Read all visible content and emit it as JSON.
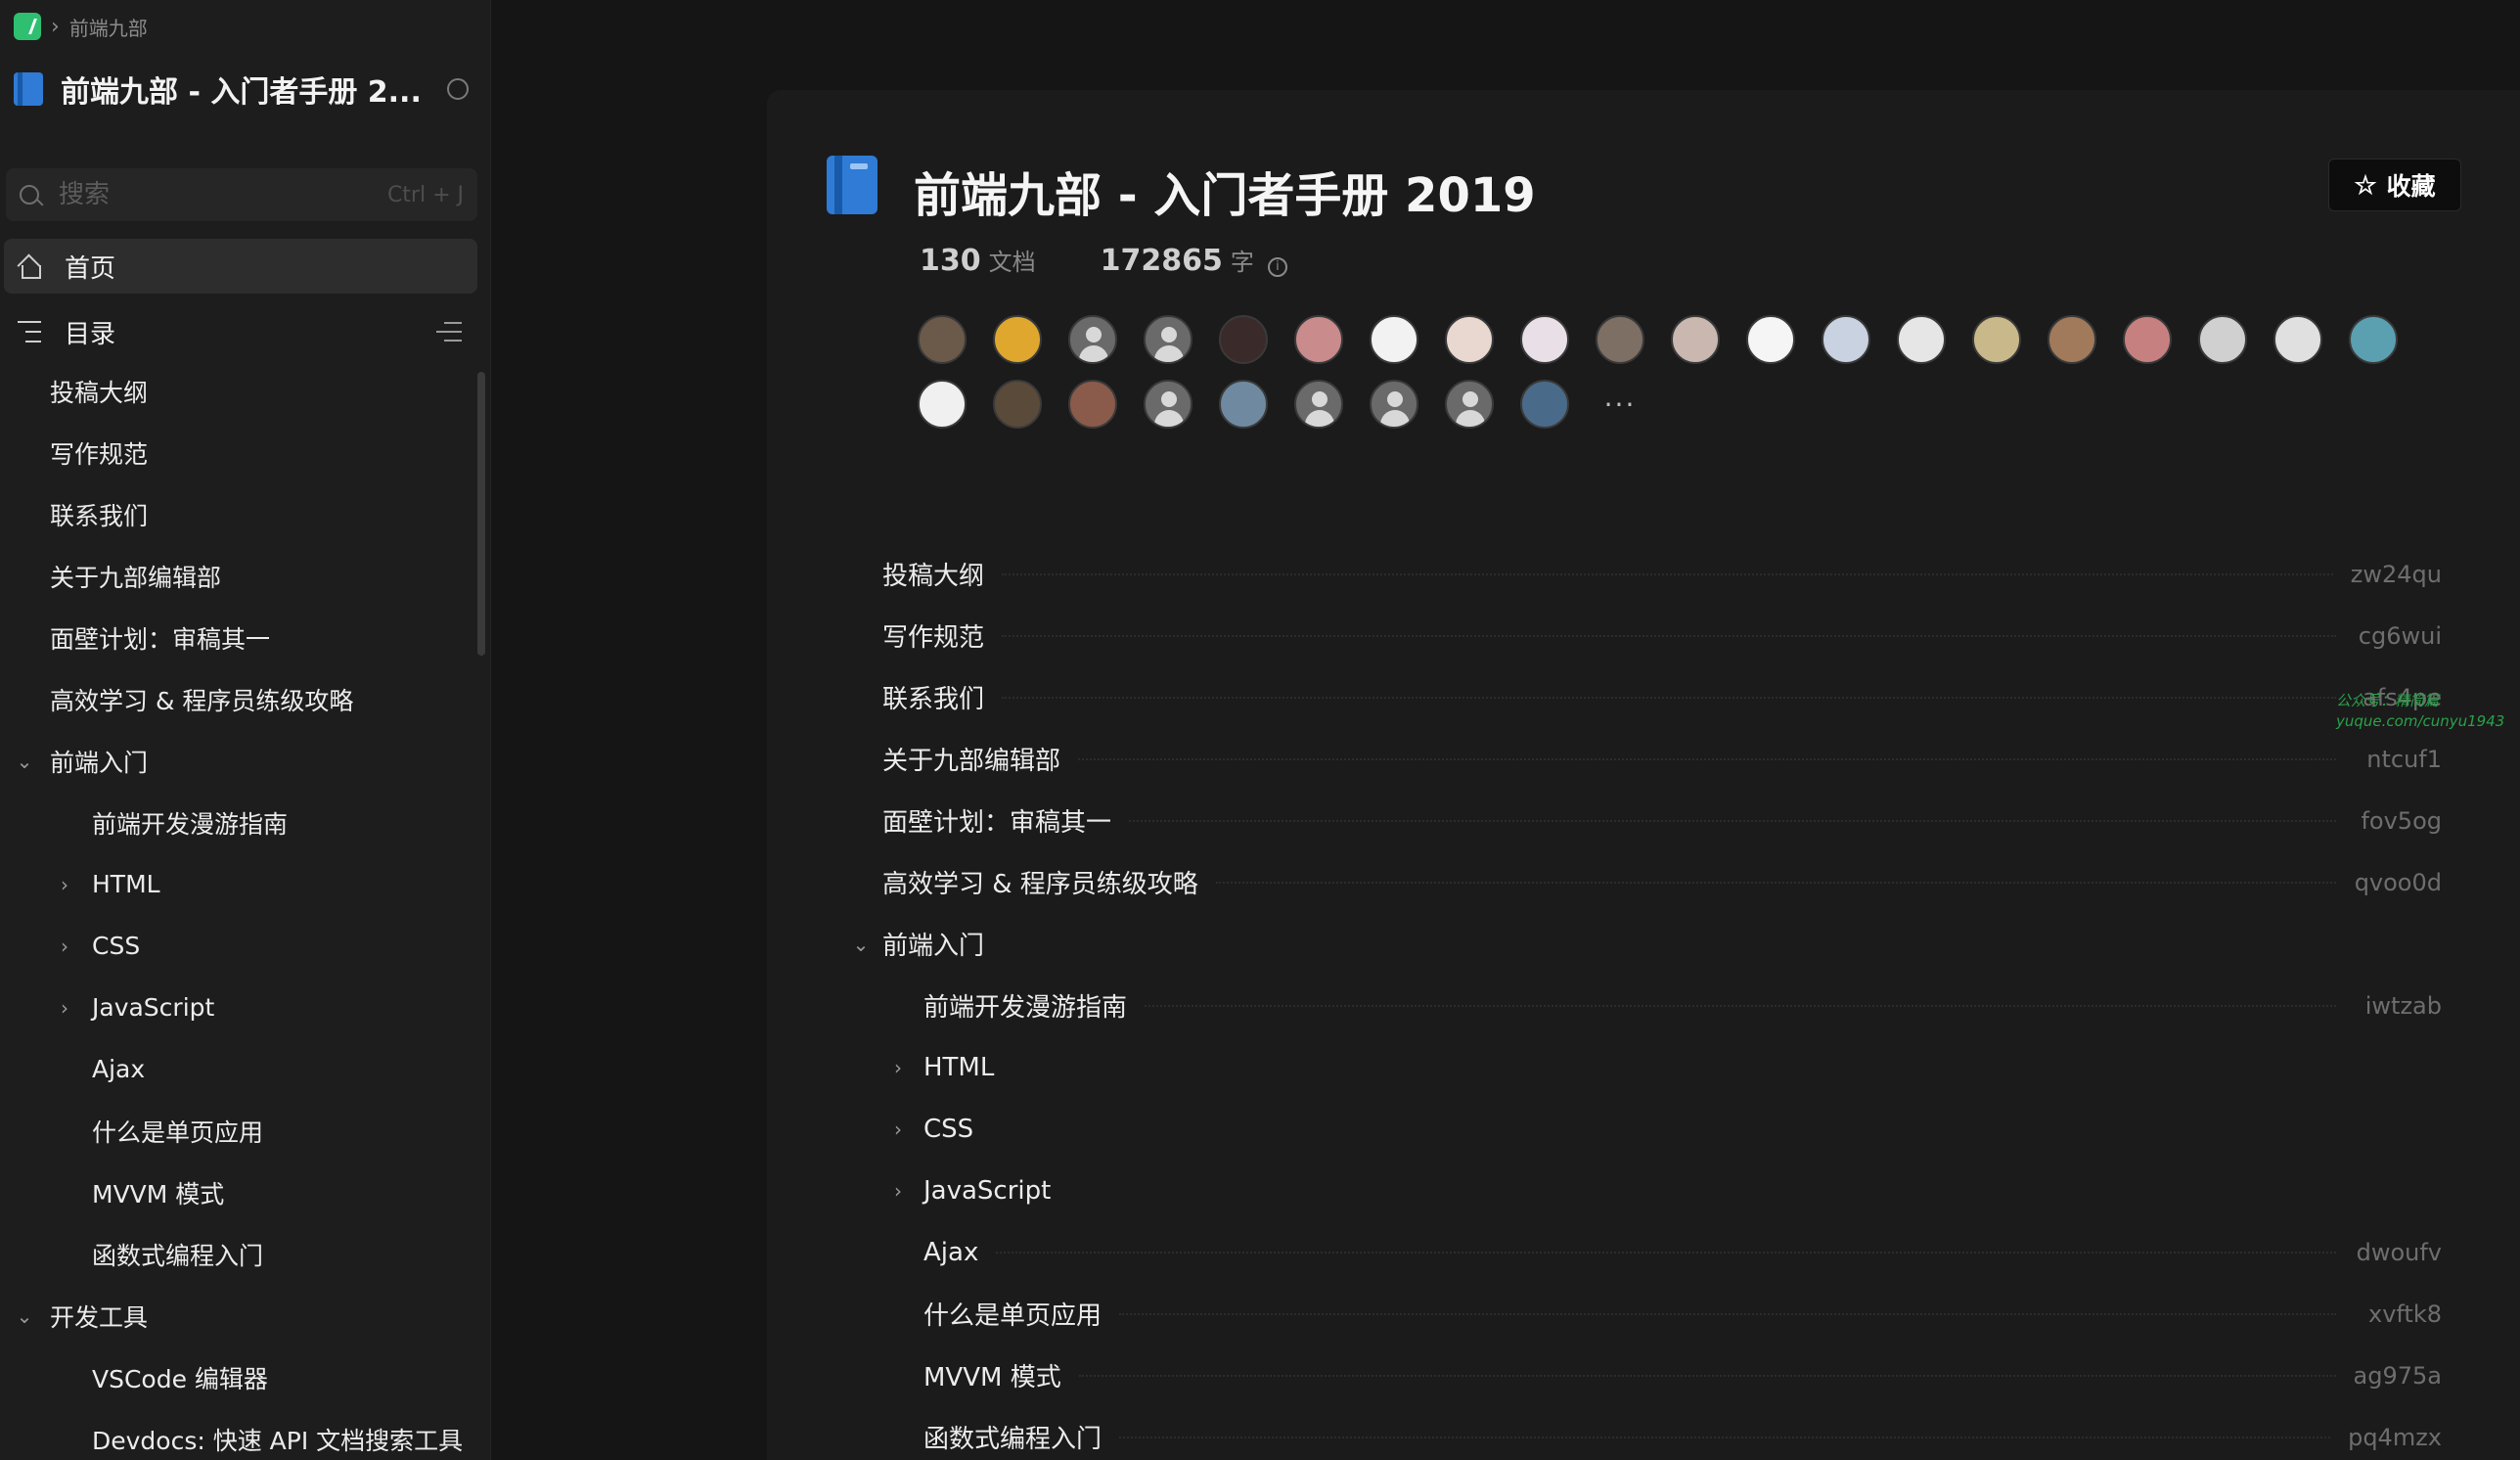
{
  "breadcrumb": {
    "current": "前端九部"
  },
  "sidebar": {
    "book_title": "前端九部 - 入门者手册 2...",
    "search_placeholder": "搜索",
    "search_shortcut": "Ctrl + J",
    "nav_home": "首页",
    "nav_toc": "目录",
    "items": [
      {
        "label": "投稿大纲",
        "level": 1,
        "caret": ""
      },
      {
        "label": "写作规范",
        "level": 1,
        "caret": ""
      },
      {
        "label": "联系我们",
        "level": 1,
        "caret": ""
      },
      {
        "label": "关于九部编辑部",
        "level": 1,
        "caret": ""
      },
      {
        "label": "面壁计划：审稿其一",
        "level": 1,
        "caret": ""
      },
      {
        "label": "高效学习 & 程序员练级攻略",
        "level": 1,
        "caret": ""
      },
      {
        "label": "前端入门",
        "level": 1,
        "caret": "⌄"
      },
      {
        "label": "前端开发漫游指南",
        "level": 2,
        "caret": ""
      },
      {
        "label": "HTML",
        "level": 2,
        "caret": "›"
      },
      {
        "label": "CSS",
        "level": 2,
        "caret": "›"
      },
      {
        "label": "JavaScript",
        "level": 2,
        "caret": "›"
      },
      {
        "label": "Ajax",
        "level": 2,
        "caret": ""
      },
      {
        "label": "什么是单页应用",
        "level": 2,
        "caret": ""
      },
      {
        "label": "MVVM 模式",
        "level": 2,
        "caret": ""
      },
      {
        "label": "函数式编程入门",
        "level": 2,
        "caret": ""
      },
      {
        "label": "开发工具",
        "level": 1,
        "caret": "⌄"
      },
      {
        "label": "VSCode 编辑器",
        "level": 2,
        "caret": ""
      },
      {
        "label": "Devdocs: 快速 API 文档搜索工具",
        "level": 2,
        "caret": ""
      }
    ]
  },
  "main": {
    "title": "前端九部 - 入门者手册 2019",
    "favorite_label": "收藏",
    "doc_count": "130",
    "doc_unit": "文档",
    "word_count": "172865",
    "word_unit": "字",
    "avatars_row1": [
      "#6b5a4a",
      "#e0a72e",
      "default",
      "default",
      "#3b2a2a",
      "#c98b8b",
      "#f2f2f2",
      "#e8d8d0",
      "#e9dfe6",
      "#7d6f64",
      "#c9b7b0",
      "#f5f5f5",
      "#c9d2e0",
      "#e6e6e6",
      "#c9b98a",
      "#a07a5a",
      "#c78080",
      "#d0d0d0",
      "#e0e0e0",
      "#5aa0b0"
    ],
    "avatars_row2": [
      "#f0f0f0",
      "#5a4a3a",
      "#8a5a4a",
      "default",
      "#6f8aa0",
      "default",
      "default",
      "default",
      "#4a6a8a"
    ],
    "more_label": "···",
    "toc": [
      {
        "title": "投稿大纲",
        "slug": "zw24qu",
        "level": 1,
        "caret": ""
      },
      {
        "title": "写作规范",
        "slug": "cg6wui",
        "level": 1,
        "caret": ""
      },
      {
        "title": "联系我们",
        "slug": "afs4pe",
        "level": 1,
        "caret": ""
      },
      {
        "title": "关于九部编辑部",
        "slug": "ntcuf1",
        "level": 1,
        "caret": ""
      },
      {
        "title": "面壁计划：审稿其一",
        "slug": "fov5og",
        "level": 1,
        "caret": ""
      },
      {
        "title": "高效学习 & 程序员练级攻略",
        "slug": "qvoo0d",
        "level": 1,
        "caret": ""
      },
      {
        "title": "前端入门",
        "slug": "",
        "level": 1,
        "caret": "⌄"
      },
      {
        "title": "前端开发漫游指南",
        "slug": "iwtzab",
        "level": 2,
        "caret": ""
      },
      {
        "title": "HTML",
        "slug": "",
        "level": 2,
        "caret": "›"
      },
      {
        "title": "CSS",
        "slug": "",
        "level": 2,
        "caret": "›"
      },
      {
        "title": "JavaScript",
        "slug": "",
        "level": 2,
        "caret": "›"
      },
      {
        "title": "Ajax",
        "slug": "dwoufv",
        "level": 2,
        "caret": ""
      },
      {
        "title": "什么是单页应用",
        "slug": "xvftk8",
        "level": 2,
        "caret": ""
      },
      {
        "title": "MVVM 模式",
        "slug": "ag975a",
        "level": 2,
        "caret": ""
      },
      {
        "title": "函数式编程入门",
        "slug": "pq4mzx",
        "level": 2,
        "caret": ""
      }
    ]
  },
  "watermark": {
    "line1": "公众号：精简篇",
    "line2": "yuque.com/cunyu1943"
  },
  "colors": {
    "accent_blue": "#2f7bd6",
    "logo_green": "#2fbf71",
    "background": "#151515"
  }
}
